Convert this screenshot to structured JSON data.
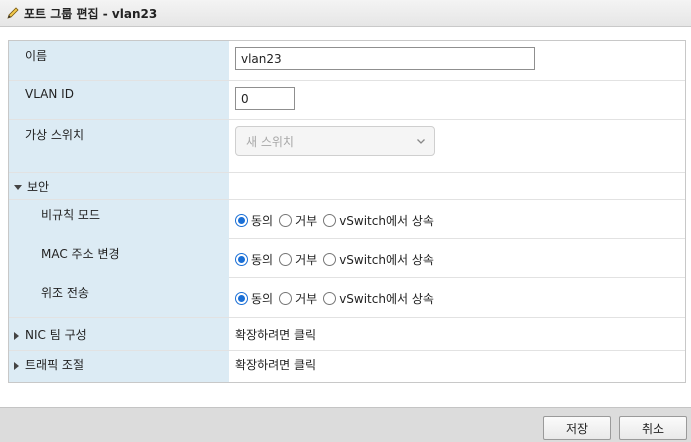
{
  "window": {
    "title": "포트 그룹 편집 - vlan23"
  },
  "form": {
    "name": {
      "label": "이름",
      "value": "vlan23"
    },
    "vlan_id": {
      "label": "VLAN ID",
      "value": "0"
    },
    "vswitch": {
      "label": "가상 스위치",
      "placeholder": "새 스위치"
    },
    "security": {
      "label": "보안",
      "rows": [
        {
          "label": "비규칙 모드",
          "options": [
            "동의",
            "거부",
            "vSwitch에서 상속"
          ],
          "selected": 0
        },
        {
          "label": "MAC 주소 변경",
          "options": [
            "동의",
            "거부",
            "vSwitch에서 상속"
          ],
          "selected": 0
        },
        {
          "label": "위조 전송",
          "options": [
            "동의",
            "거부",
            "vSwitch에서 상속"
          ],
          "selected": 0
        }
      ]
    },
    "nic_teaming": {
      "label": "NIC 팀 구성",
      "value": "확장하려면 클릭"
    },
    "traffic_shaping": {
      "label": "트래픽 조절",
      "value": "확장하려면 클릭"
    }
  },
  "footer": {
    "save_label": "저장",
    "cancel_label": "취소"
  },
  "colors": {
    "label_column": "#dcebf4",
    "radio_accent": "#1a6fd6"
  }
}
